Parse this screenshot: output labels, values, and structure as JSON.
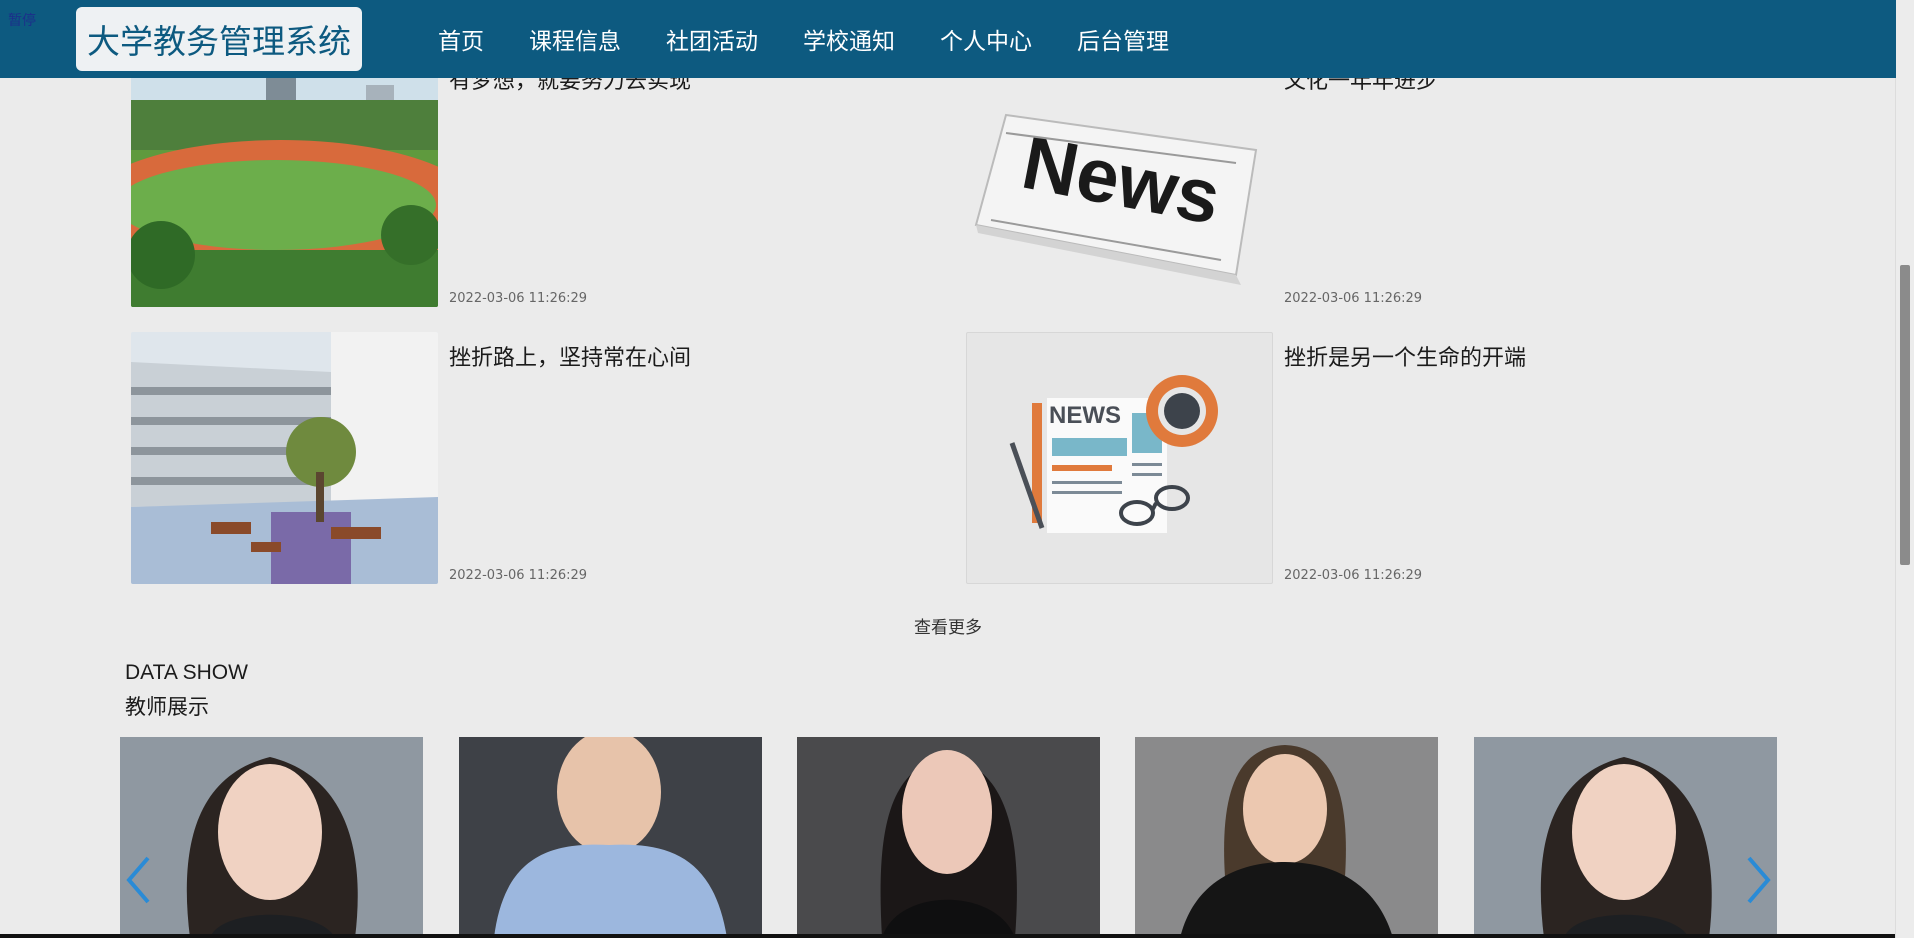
{
  "overlay": {
    "pause_text": "暂停"
  },
  "header": {
    "logo": "大学教务管理系统",
    "nav": [
      "首页",
      "课程信息",
      "社团活动",
      "学校通知",
      "个人中心",
      "后台管理"
    ]
  },
  "news": [
    {
      "title": "有梦想，就要努力去实现",
      "date": "2022-03-06 11:26:29",
      "image": "campus-track-photo"
    },
    {
      "title": "文化一年年进步",
      "date": "2022-03-06 11:26:29",
      "image": "newspaper-photo"
    },
    {
      "title": "挫折路上，坚持常在心间",
      "date": "2022-03-06 11:26:29",
      "image": "campus-building-photo"
    },
    {
      "title": "挫折是另一个生命的开端",
      "date": "2022-03-06 11:26:29",
      "image": "news-illustration"
    }
  ],
  "more_label": "查看更多",
  "section": {
    "en": "DATA SHOW",
    "cn": "教师展示"
  },
  "teachers": [
    "teacher-photo-1",
    "teacher-photo-2",
    "teacher-photo-3",
    "teacher-photo-4",
    "teacher-photo-5"
  ],
  "colors": {
    "header_bg": "#0d5a80",
    "page_bg": "#ebebeb",
    "arrow": "#2a8bd6"
  },
  "icons": {
    "prev": "chevron-left-icon",
    "next": "chevron-right-icon"
  }
}
